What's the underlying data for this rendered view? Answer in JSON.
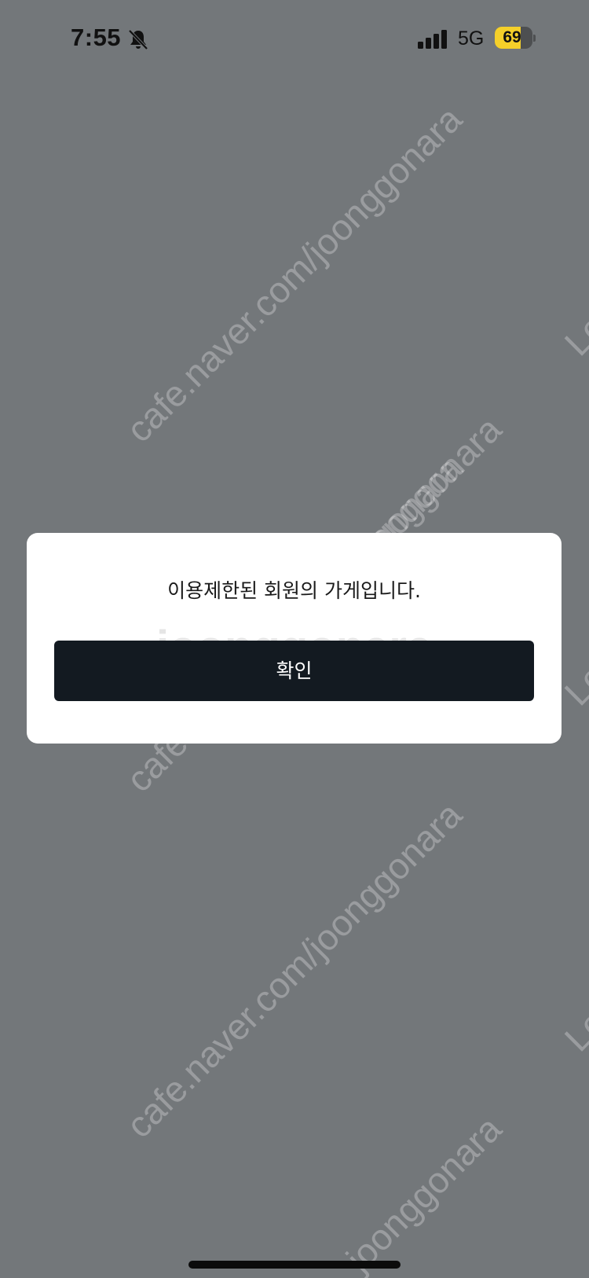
{
  "status_bar": {
    "time": "7:55",
    "network": "5G",
    "battery_level": "69",
    "battery_fraction": 0.69
  },
  "icons": {
    "silent": "bell-slash-icon",
    "signal": "cellular-signal-icon",
    "battery": "battery-icon"
  },
  "watermark": {
    "url_text": "cafe.naver.com/joonggonara",
    "brand_text": "joonggonara",
    "edge_text": "Lov"
  },
  "dialog": {
    "message": "이용제한된 회원의 가게입니다.",
    "confirm_label": "확인"
  },
  "colors": {
    "backdrop": "#73777a",
    "dialog_bg": "#ffffff",
    "button_bg": "#131a21",
    "button_text": "#ffffff",
    "battery_fill": "#f5d02a"
  }
}
